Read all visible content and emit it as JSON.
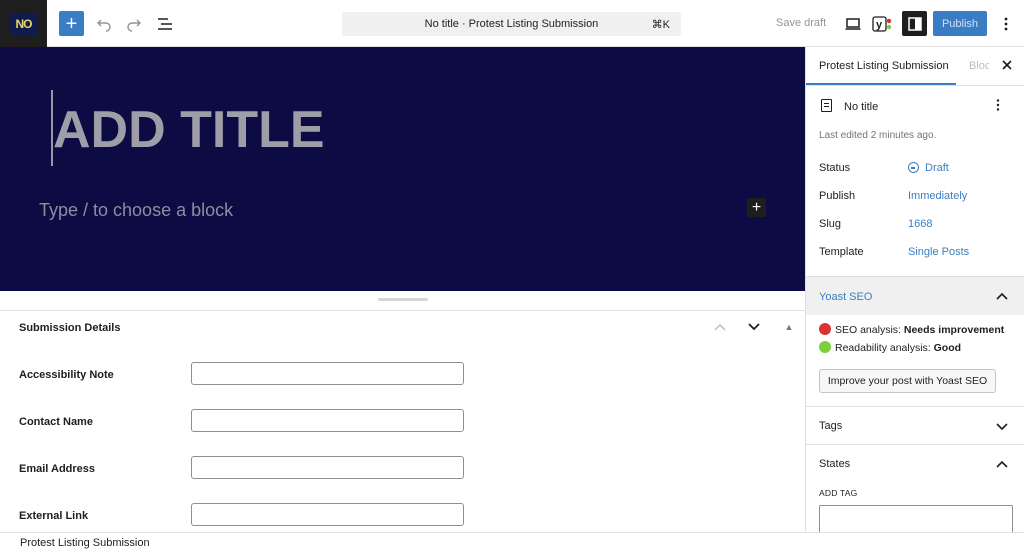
{
  "topbar": {
    "logo_text": "NO",
    "document_title": "No title · Protest Listing Submission",
    "command_shortcut": "⌘K",
    "save_draft_label": "Save draft",
    "publish_label": "Publish"
  },
  "editor": {
    "title_placeholder": "ADD TITLE",
    "block_placeholder": "Type / to choose a block"
  },
  "metabox": {
    "title": "Submission Details",
    "fields": [
      {
        "label": "Accessibility Note",
        "value": ""
      },
      {
        "label": "Contact Name",
        "value": ""
      },
      {
        "label": "Email Address",
        "value": ""
      },
      {
        "label": "External Link",
        "value": ""
      }
    ]
  },
  "footer": {
    "breadcrumb": "Protest Listing Submission"
  },
  "sidebar": {
    "tab_post": "Protest Listing Submission",
    "tab_block": "Block",
    "post_name": "No title",
    "last_edited": "Last edited 2 minutes ago.",
    "props": {
      "status_label": "Status",
      "status_value": "Draft",
      "publish_label": "Publish",
      "publish_value": "Immediately",
      "slug_label": "Slug",
      "slug_value": "1668",
      "template_label": "Template",
      "template_value": "Single Posts"
    },
    "yoast": {
      "title": "Yoast SEO",
      "seo_prefix": "SEO analysis: ",
      "seo_result": "Needs improvement",
      "readability_prefix": "Readability analysis: ",
      "readability_result": "Good",
      "improve_label": "Improve your post with Yoast SEO"
    },
    "tags_title": "Tags",
    "states_title": "States",
    "add_tag_label": "ADD TAG"
  },
  "colors": {
    "accent": "#3b7dc4",
    "canvas_bg": "#0c0b43",
    "seo_bad": "#dc3232",
    "readability_good": "#7ad03a"
  }
}
